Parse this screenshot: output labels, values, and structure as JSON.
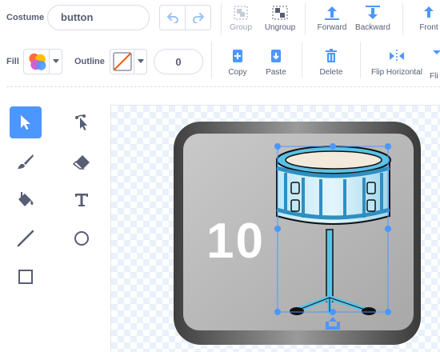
{
  "costume": {
    "label": "Costume",
    "name_value": "button"
  },
  "history": {
    "undo_icon": "undo-icon",
    "redo_icon": "redo-icon"
  },
  "arrange": {
    "group": "Group",
    "ungroup": "Ungroup",
    "forward": "Forward",
    "backward": "Backward",
    "front": "Front"
  },
  "style": {
    "fill_label": "Fill",
    "outline_label": "Outline",
    "outline_width": "0"
  },
  "actions": {
    "copy": "Copy",
    "paste": "Paste",
    "delete": "Delete",
    "flip_horizontal": "Flip Horizontal",
    "flip_vertical": "Fli"
  },
  "tools": [
    "select-tool",
    "reshape-tool",
    "brush-tool",
    "eraser-tool",
    "fill-tool",
    "text-tool",
    "line-tool",
    "circle-tool",
    "rectangle-tool"
  ],
  "artwork": {
    "button_number": "10"
  },
  "colors": {
    "accent": "#4c97ff",
    "text": "#575e75",
    "disabled": "#a0a6b5"
  }
}
